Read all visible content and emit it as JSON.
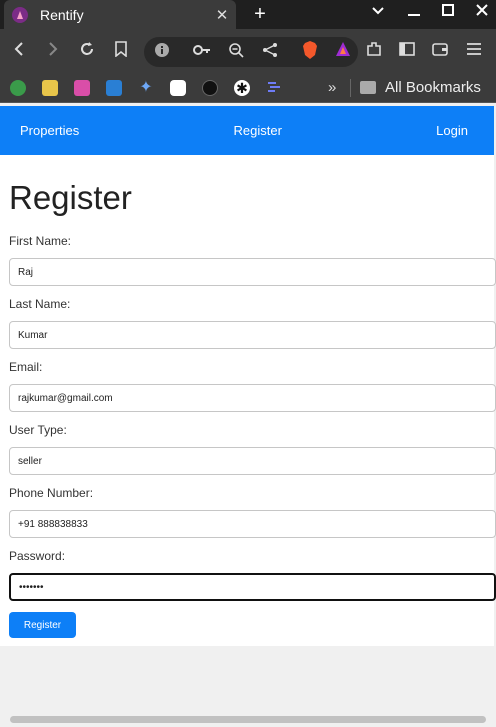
{
  "browser": {
    "tab_title": "Rentify",
    "tab_close": "✕",
    "new_tab": "+",
    "bookmarks_more": "»",
    "all_bookmarks": "All Bookmarks"
  },
  "nav": {
    "properties": "Properties",
    "register": "Register",
    "login": "Login"
  },
  "form": {
    "heading": "Register",
    "first_name_label": "First Name:",
    "first_name_value": "Raj",
    "last_name_label": "Last Name:",
    "last_name_value": "Kumar",
    "email_label": "Email:",
    "email_value": "rajkumar@gmail.com",
    "user_type_label": "User Type:",
    "user_type_value": "seller",
    "phone_label": "Phone Number:",
    "phone_value": "+91 888838833",
    "password_label": "Password:",
    "password_value": "•••••••",
    "submit_label": "Register"
  }
}
